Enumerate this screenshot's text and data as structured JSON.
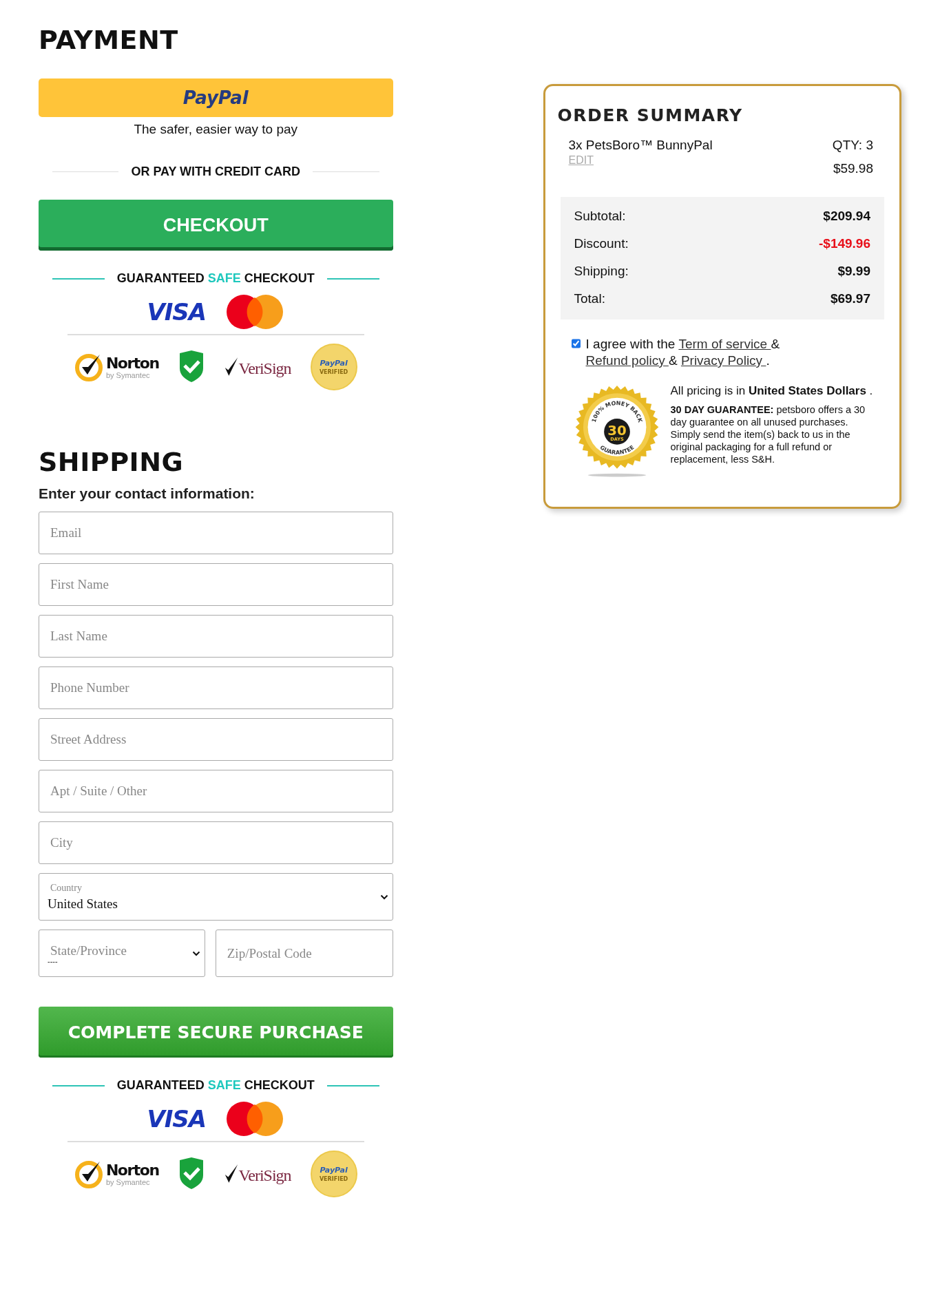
{
  "payment": {
    "title": "PAYMENT",
    "paypal_button": {
      "label": "PayPal"
    },
    "paypal_tagline": "The safer, easier way to pay",
    "divider_label": "OR PAY WITH CREDIT CARD",
    "checkout_button": "CHECKOUT"
  },
  "trust_sections": [
    {
      "heading": {
        "before": "GUARANTEED",
        "highlight": "SAFE",
        "after": "CHECKOUT"
      },
      "card_logo": "VISA",
      "norton": {
        "name": "Norton",
        "tagline": "by Symantec"
      },
      "verisign": "VeriSign",
      "paypal_seal": {
        "name": "PayPal",
        "caption": "VERIFIED"
      }
    },
    {
      "heading": {
        "before": "GUARANTEED",
        "highlight": "SAFE",
        "after": "CHECKOUT"
      },
      "card_logo": "VISA",
      "norton": {
        "name": "Norton",
        "tagline": "by Symantec"
      },
      "verisign": "VeriSign",
      "paypal_seal": {
        "name": "PayPal",
        "caption": "VERIFIED"
      }
    }
  ],
  "shipping": {
    "title": "SHIPPING",
    "subtitle": "Enter your contact information:",
    "fields": [
      {
        "kind": "input",
        "placeholder": "Email"
      },
      {
        "kind": "input",
        "placeholder": "First Name"
      },
      {
        "kind": "input",
        "placeholder": "Last Name"
      },
      {
        "kind": "input",
        "placeholder": "Phone Number"
      },
      {
        "kind": "input",
        "placeholder": "Street Address"
      },
      {
        "kind": "input",
        "placeholder": "Apt / Suite / Other"
      },
      {
        "kind": "input",
        "placeholder": "City"
      },
      {
        "kind": "select",
        "label": "Country",
        "value": "United States"
      }
    ],
    "pair": [
      {
        "kind": "select",
        "placeholder": "State/Province",
        "value": "----"
      },
      {
        "kind": "input",
        "placeholder": "Zip/Postal Code"
      }
    ],
    "purchase_button": "COMPLETE SECURE PURCHASE"
  },
  "order_summary": {
    "title": "ORDER SUMMARY",
    "items": [
      {
        "name": "3x PetsBoro™ BunnyPal",
        "edit": "EDIT",
        "qty": "QTY: 3",
        "price": "$59.98"
      }
    ],
    "totals": [
      {
        "label": "Subtotal:",
        "value": "$209.94",
        "kind": "normal"
      },
      {
        "label": "Discount:",
        "value": "-$149.96",
        "kind": "discount"
      },
      {
        "label": "Shipping:",
        "value": "$9.99",
        "kind": "normal"
      },
      {
        "label": "Total:",
        "value": "$69.97",
        "kind": "normal"
      }
    ],
    "agreement": {
      "checked": true,
      "segments": [
        {
          "text": "I agree with the ",
          "link": false
        },
        {
          "text": "Term of service ",
          "link": true
        },
        {
          "text": "& ",
          "link": false
        },
        {
          "text": "Refund policy ",
          "link": true
        },
        {
          "text": "& ",
          "link": false
        },
        {
          "text": "Privacy Policy ",
          "link": true
        },
        {
          "text": ".",
          "link": false
        }
      ]
    },
    "seal": {
      "top": "100% MONEY BACK",
      "number": "30",
      "unit": "DAYS",
      "bottom": "GUARANTEE"
    },
    "pricing_note": "All pricing is in **United States Dollars** .",
    "guarantee_text": "**30 DAY GUARANTEE:** petsboro offers a 30 day guarantee on all unused purchases. Simply send the item(s) back to us in the original packaging for a full refund or replacement, less S&H."
  }
}
